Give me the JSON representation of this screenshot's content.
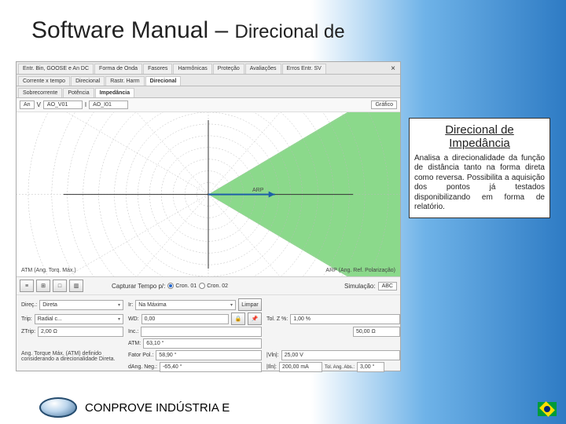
{
  "title": {
    "main": "Software Manual – ",
    "small": "Direcional de"
  },
  "tabs_top": [
    "Entr. Bin, GOOSE e An DC",
    "Forma de Onda",
    "Fasores",
    "Harmônicas",
    "Proteção",
    "Avaliações",
    "Erros Entr. SV"
  ],
  "tabs_mid": [
    "Corrente x tempo",
    "Direcional",
    "Rastr. Harm",
    "Direcional"
  ],
  "tabs_mid_active": 3,
  "tabs_bot": [
    "Sobrecorrente",
    "Potência",
    "Impedância"
  ],
  "tabs_bot_active": 2,
  "sel_row": {
    "an": "An",
    "v_field": "V",
    "v_chan": "AO_V01",
    "i_field": "I",
    "i_chan": "AO_I01",
    "right": "Gráfico"
  },
  "chart": {
    "arp_label": "ARP",
    "atm_label": "ATM (Ang. Torq. Máx.)",
    "arp_axis": "ARP (Ang. Ref. Polarização)"
  },
  "btn_row": {
    "icons": [
      "≡",
      "⊞",
      "□",
      "▥"
    ],
    "capture_label": "Capturar Tempo p/:",
    "cron01": "Cron. 01",
    "cron02": "Cron. 02",
    "sim_label": "Simulação:",
    "sim_val": "ABC"
  },
  "params": {
    "left": [
      {
        "lbl": "Direç.:",
        "val": "Direta",
        "type": "sel"
      },
      {
        "lbl": "Trip:",
        "val": "Radial c...",
        "type": "sel"
      },
      {
        "lbl": "ZTrip:",
        "val": "2,00 Ω",
        "type": "val"
      }
    ],
    "mid": [
      {
        "lbl": "Ir:",
        "val": "Na Máxima",
        "type": "sel",
        "extra": "Limpar"
      },
      {
        "lbl": "WD:",
        "val": "0,00",
        "type": "val",
        "btns": true
      },
      {
        "lbl": "Inc.:",
        "val": "",
        "type": "val"
      },
      {
        "lbl": "ATM:",
        "val": "63,10 °",
        "type": "val"
      },
      {
        "lbl": "Fator Pol.:",
        "val": "58,90 °",
        "type": "val"
      },
      {
        "lbl": "dAng. Neg.:",
        "val": "-65,40 °",
        "type": "val"
      }
    ],
    "right": [
      {
        "lbl": "",
        "val": ""
      },
      {
        "lbl": "Tol. Z %:",
        "val": "1,00 %"
      },
      {
        "lbl": "",
        "val": "50,00 Ω"
      },
      {
        "lbl": "|Vln|:",
        "val": "25,00 V"
      },
      {
        "lbl": "|Iln|:",
        "val": "200,00 mA"
      },
      {
        "lbl": "Tol. Ang. Abs.:",
        "val": "3,00 °"
      }
    ],
    "atm_note": "Ang. Torque Máx. (ATM) definido considerando a direcionalidade Direta."
  },
  "callout": {
    "title": "Direcional de Impedância",
    "body": "Analisa a direcionalidade da função de distância tanto na forma direta como reversa. Possibilita a aquisição dos pontos já testados disponibilizando em forma de relatório."
  },
  "footer": "CONPROVE INDÚSTRIA E"
}
